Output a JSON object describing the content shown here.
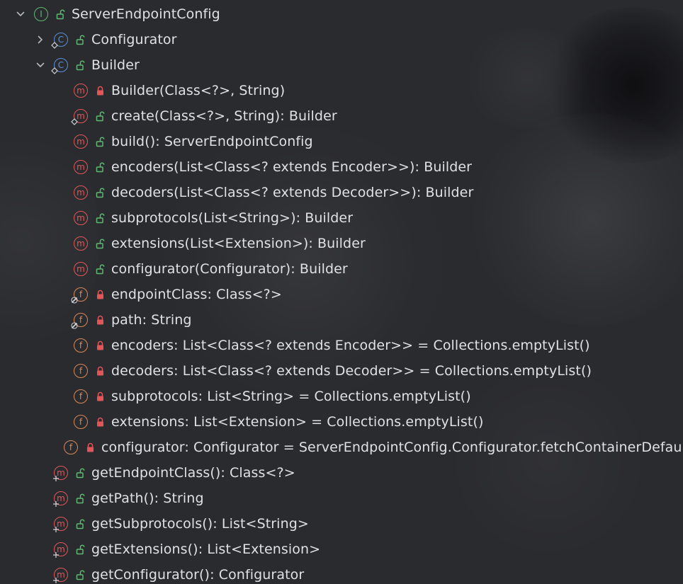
{
  "colors": {
    "interface": "#5fb872",
    "class": "#5c8fd6",
    "method": "#e2565a",
    "field": "#d9895a",
    "public": "#5fb872",
    "private": "#e2565a",
    "text": "#dfe1e5"
  },
  "tree": [
    {
      "label": "ServerEndpointConfig",
      "depth": 0,
      "expander": "expanded",
      "kind": "interface",
      "kind_letter": "I",
      "visibility": "public"
    },
    {
      "label": "Configurator",
      "depth": 1,
      "expander": "collapsed",
      "kind": "class",
      "kind_letter": "C",
      "visibility": "public",
      "static": true
    },
    {
      "label": "Builder",
      "depth": 1,
      "expander": "expanded",
      "kind": "class",
      "kind_letter": "C",
      "visibility": "public",
      "static": true
    },
    {
      "label": "Builder(Class<?>, String)",
      "depth": 2,
      "expander": "none",
      "kind": "method",
      "kind_letter": "m",
      "visibility": "private"
    },
    {
      "label": "create(Class<?>, String): Builder",
      "depth": 2,
      "expander": "none",
      "kind": "method",
      "kind_letter": "m",
      "visibility": "public",
      "static": true
    },
    {
      "label": "build(): ServerEndpointConfig",
      "depth": 2,
      "expander": "none",
      "kind": "method",
      "kind_letter": "m",
      "visibility": "public"
    },
    {
      "label": "encoders(List<Class<? extends Encoder>>): Builder",
      "depth": 2,
      "expander": "none",
      "kind": "method",
      "kind_letter": "m",
      "visibility": "public"
    },
    {
      "label": "decoders(List<Class<? extends Decoder>>): Builder",
      "depth": 2,
      "expander": "none",
      "kind": "method",
      "kind_letter": "m",
      "visibility": "public"
    },
    {
      "label": "subprotocols(List<String>): Builder",
      "depth": 2,
      "expander": "none",
      "kind": "method",
      "kind_letter": "m",
      "visibility": "public"
    },
    {
      "label": "extensions(List<Extension>): Builder",
      "depth": 2,
      "expander": "none",
      "kind": "method",
      "kind_letter": "m",
      "visibility": "public"
    },
    {
      "label": "configurator(Configurator): Builder",
      "depth": 2,
      "expander": "none",
      "kind": "method",
      "kind_letter": "m",
      "visibility": "public"
    },
    {
      "label": "endpointClass: Class<?>",
      "depth": 2,
      "expander": "none",
      "kind": "field",
      "kind_letter": "f",
      "visibility": "private",
      "final": true
    },
    {
      "label": "path: String",
      "depth": 2,
      "expander": "none",
      "kind": "field",
      "kind_letter": "f",
      "visibility": "private",
      "final": true
    },
    {
      "label": "encoders: List<Class<? extends Encoder>> = Collections.emptyList()",
      "depth": 2,
      "expander": "none",
      "kind": "field",
      "kind_letter": "f",
      "visibility": "private"
    },
    {
      "label": "decoders: List<Class<? extends Decoder>> = Collections.emptyList()",
      "depth": 2,
      "expander": "none",
      "kind": "field",
      "kind_letter": "f",
      "visibility": "private"
    },
    {
      "label": "subprotocols: List<String> = Collections.emptyList()",
      "depth": 2,
      "expander": "none",
      "kind": "field",
      "kind_letter": "f",
      "visibility": "private"
    },
    {
      "label": "extensions: List<Extension> = Collections.emptyList()",
      "depth": 2,
      "expander": "none",
      "kind": "field",
      "kind_letter": "f",
      "visibility": "private"
    },
    {
      "label": "configurator: Configurator = ServerEndpointConfig.Configurator.fetchContainerDefaultC",
      "depth": 2,
      "expander": "none",
      "kind": "field",
      "kind_letter": "f",
      "visibility": "private"
    },
    {
      "label": "getEndpointClass(): Class<?>",
      "depth": 1,
      "expander": "none",
      "kind": "method",
      "kind_letter": "m",
      "visibility": "public",
      "abstract": true
    },
    {
      "label": "getPath(): String",
      "depth": 1,
      "expander": "none",
      "kind": "method",
      "kind_letter": "m",
      "visibility": "public",
      "abstract": true
    },
    {
      "label": "getSubprotocols(): List<String>",
      "depth": 1,
      "expander": "none",
      "kind": "method",
      "kind_letter": "m",
      "visibility": "public",
      "abstract": true
    },
    {
      "label": "getExtensions(): List<Extension>",
      "depth": 1,
      "expander": "none",
      "kind": "method",
      "kind_letter": "m",
      "visibility": "public",
      "abstract": true
    },
    {
      "label": "getConfigurator(): Configurator",
      "depth": 1,
      "expander": "none",
      "kind": "method",
      "kind_letter": "m",
      "visibility": "public",
      "abstract": true
    }
  ]
}
